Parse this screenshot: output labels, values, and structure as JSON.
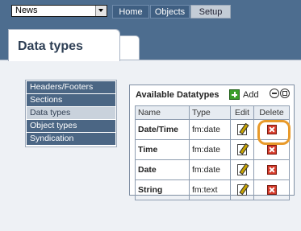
{
  "header": {
    "site_select_value": "News",
    "nav": [
      {
        "label": "Home"
      },
      {
        "label": "Objects"
      },
      {
        "label": "Setup"
      }
    ]
  },
  "page": {
    "tab_title": "Data types"
  },
  "sidebar": {
    "items": [
      {
        "label": "Headers/Footers"
      },
      {
        "label": "Sections"
      },
      {
        "label": "Data types",
        "active": true
      },
      {
        "label": "Object types"
      },
      {
        "label": "Syndication"
      }
    ]
  },
  "datatypes": {
    "title": "Available Datatypes",
    "add_label": "Add",
    "columns": [
      "Name",
      "Type",
      "Edit",
      "Delete"
    ],
    "rows": [
      {
        "name": "Date/Time",
        "type": "fm:date"
      },
      {
        "name": "Time",
        "type": "fm:date"
      },
      {
        "name": "Date",
        "type": "fm:date"
      },
      {
        "name": "String",
        "type": "fm:text"
      }
    ]
  },
  "colors": {
    "background": "#4d6d8f",
    "menu_item": "#4b6684",
    "highlight": "#e89a2a",
    "delete": "#d63a2a"
  },
  "icons": [
    "chevron-down-icon",
    "add-icon",
    "collapse-icon",
    "maximize-icon",
    "edit-icon",
    "delete-icon"
  ]
}
